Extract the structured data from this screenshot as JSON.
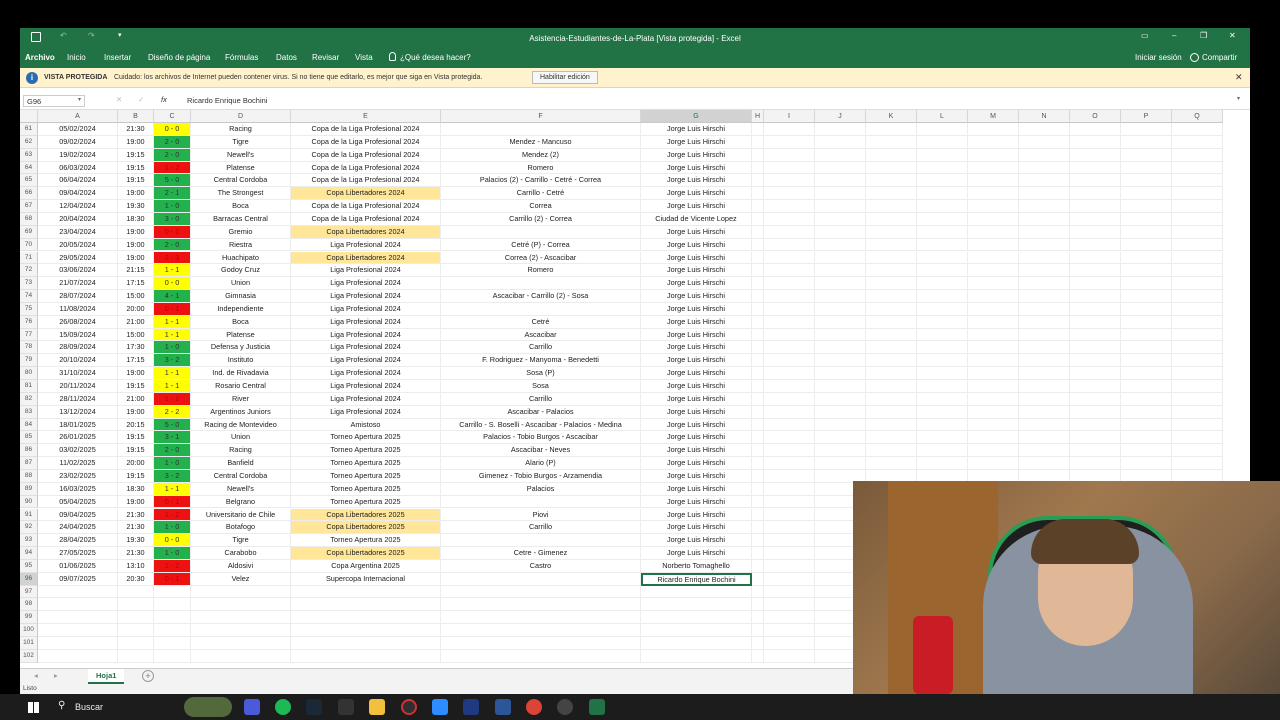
{
  "window": {
    "title": "Asistencia-Estudiantes-de-La-Plata  [Vista protegida]  -  Excel"
  },
  "ribbon": {
    "tabs": [
      "Archivo",
      "Inicio",
      "Insertar",
      "Diseño de página",
      "Fórmulas",
      "Datos",
      "Revisar",
      "Vista"
    ],
    "tell_me": "¿Qué desea hacer?",
    "signin": "Iniciar sesión",
    "share": "Compartir"
  },
  "protected": {
    "label": "VISTA PROTEGIDA",
    "message": "Cuidado: los archivos de Internet pueden contener virus. Si no tiene que editarlo, es mejor que siga en Vista protegida.",
    "enable_button": "Habilitar edición"
  },
  "formula": {
    "name_box": "G96",
    "fx": "fx",
    "value": "Ricardo Enrique Bochini"
  },
  "columns": [
    "A",
    "B",
    "C",
    "D",
    "E",
    "F",
    "G",
    "H",
    "I",
    "J",
    "K",
    "L",
    "M",
    "N",
    "O",
    "P",
    "Q"
  ],
  "colors": {
    "green": "#22b14c",
    "yellow": "#ffff00",
    "red": "#ee1111",
    "copa": "#ffe699",
    "excel": "#217346"
  },
  "rows": [
    {
      "n": "61",
      "a": "05/02/2024",
      "b": "21:30",
      "c": "0 - 0",
      "r": "D",
      "d": "Racing",
      "e": "Copa de la Liga Profesional 2024",
      "f": "",
      "g": "Jorge Luis Hirschi"
    },
    {
      "n": "62",
      "a": "09/02/2024",
      "b": "19:00",
      "c": "2 - 0",
      "r": "W",
      "d": "Tigre",
      "e": "Copa de la Liga Profesional 2024",
      "f": "Mendez - Mancuso",
      "g": "Jorge Luis Hirschi"
    },
    {
      "n": "63",
      "a": "19/02/2024",
      "b": "19:15",
      "c": "2 - 0",
      "r": "W",
      "d": "Newell's",
      "e": "Copa de la Liga Profesional 2024",
      "f": "Mendez (2)",
      "g": "Jorge Luis Hirschi"
    },
    {
      "n": "64",
      "a": "06/03/2024",
      "b": "19:15",
      "c": "1 - 2",
      "r": "L",
      "d": "Platense",
      "e": "Copa de la Liga Profesional 2024",
      "f": "Romero",
      "g": "Jorge Luis Hirschi"
    },
    {
      "n": "65",
      "a": "06/04/2024",
      "b": "19:15",
      "c": "5 - 0",
      "r": "W",
      "d": "Central Cordoba",
      "e": "Copa de la Liga Profesional 2024",
      "f": "Palacios (2) - Carrillo - Cetré - Correa",
      "g": "Jorge Luis Hirschi"
    },
    {
      "n": "66",
      "a": "09/04/2024",
      "b": "19:00",
      "c": "2 - 1",
      "r": "W",
      "d": "The Strongest",
      "e": "Copa Libertadores 2024",
      "f": "Carrillo - Cetré",
      "g": "Jorge Luis Hirschi"
    },
    {
      "n": "67",
      "a": "12/04/2024",
      "b": "19:30",
      "c": "1 - 0",
      "r": "W",
      "d": "Boca",
      "e": "Copa de la Liga Profesional 2024",
      "f": "Correa",
      "g": "Jorge Luis Hirschi"
    },
    {
      "n": "68",
      "a": "20/04/2024",
      "b": "18:30",
      "c": "3 - 0",
      "r": "W",
      "d": "Barracas Central",
      "e": "Copa de la Liga Profesional 2024",
      "f": "Carrillo (2) - Correa",
      "g": "Ciudad de Vicente Lopez"
    },
    {
      "n": "69",
      "a": "23/04/2024",
      "b": "19:00",
      "c": "0 - 1",
      "r": "L",
      "d": "Gremio",
      "e": "Copa Libertadores 2024",
      "f": "",
      "g": "Jorge Luis Hirschi"
    },
    {
      "n": "70",
      "a": "20/05/2024",
      "b": "19:00",
      "c": "2 - 0",
      "r": "W",
      "d": "Riestra",
      "e": "Liga Profesional 2024",
      "f": "Cetré (P) - Correa",
      "g": "Jorge Luis Hirschi"
    },
    {
      "n": "71",
      "a": "29/05/2024",
      "b": "19:00",
      "c": "2 - 3",
      "r": "L",
      "d": "Huachipato",
      "e": "Copa Libertadores 2024",
      "f": "Correa (2) - Ascacibar",
      "g": "Jorge Luis Hirschi"
    },
    {
      "n": "72",
      "a": "03/06/2024",
      "b": "21:15",
      "c": "1 - 1",
      "r": "D",
      "d": "Godoy Cruz",
      "e": "Liga Profesional 2024",
      "f": "Romero",
      "g": "Jorge Luis Hirschi"
    },
    {
      "n": "73",
      "a": "21/07/2024",
      "b": "17:15",
      "c": "0 - 0",
      "r": "D",
      "d": "Union",
      "e": "Liga Profesional 2024",
      "f": "",
      "g": "Jorge Luis Hirschi"
    },
    {
      "n": "74",
      "a": "28/07/2024",
      "b": "15:00",
      "c": "4 - 1",
      "r": "W",
      "d": "Gimnasia",
      "e": "Liga Profesional 2024",
      "f": "Ascacibar - Carrillo (2) - Sosa",
      "g": "Jorge Luis Hirschi"
    },
    {
      "n": "75",
      "a": "11/08/2024",
      "b": "20:00",
      "c": "0 - 1",
      "r": "L",
      "d": "Independiente",
      "e": "Liga Profesional 2024",
      "f": "",
      "g": "Jorge Luis Hirschi"
    },
    {
      "n": "76",
      "a": "26/08/2024",
      "b": "21:00",
      "c": "1 - 1",
      "r": "D",
      "d": "Boca",
      "e": "Liga Profesional 2024",
      "f": "Cetré",
      "g": "Jorge Luis Hirschi"
    },
    {
      "n": "77",
      "a": "15/09/2024",
      "b": "15:00",
      "c": "1 - 1",
      "r": "D",
      "d": "Platense",
      "e": "Liga Profesional 2024",
      "f": "Ascacibar",
      "g": "Jorge Luis Hirschi"
    },
    {
      "n": "78",
      "a": "28/09/2024",
      "b": "17:30",
      "c": "1 - 0",
      "r": "W",
      "d": "Defensa y Justicia",
      "e": "Liga Profesional 2024",
      "f": "Carrillo",
      "g": "Jorge Luis Hirschi"
    },
    {
      "n": "79",
      "a": "20/10/2024",
      "b": "17:15",
      "c": "3 - 2",
      "r": "W",
      "d": "Instituto",
      "e": "Liga Profesional 2024",
      "f": "F. Rodriguez - Manyoma - Benedetti",
      "g": "Jorge Luis Hirschi"
    },
    {
      "n": "80",
      "a": "31/10/2024",
      "b": "19:00",
      "c": "1 - 1",
      "r": "D",
      "d": "Ind. de Rivadavia",
      "e": "Liga Profesional 2024",
      "f": "Sosa (P)",
      "g": "Jorge Luis Hirschi"
    },
    {
      "n": "81",
      "a": "20/11/2024",
      "b": "19:15",
      "c": "1 - 1",
      "r": "D",
      "d": "Rosario Central",
      "e": "Liga Profesional 2024",
      "f": "Sosa",
      "g": "Jorge Luis Hirschi"
    },
    {
      "n": "82",
      "a": "28/11/2024",
      "b": "21:00",
      "c": "1 - 2",
      "r": "L",
      "d": "River",
      "e": "Liga Profesional 2024",
      "f": "Carrillo",
      "g": "Jorge Luis Hirschi"
    },
    {
      "n": "83",
      "a": "13/12/2024",
      "b": "19:00",
      "c": "2 - 2",
      "r": "D",
      "d": "Argentinos Juniors",
      "e": "Liga Profesional 2024",
      "f": "Ascacibar - Palacios",
      "g": "Jorge Luis Hirschi"
    },
    {
      "n": "84",
      "a": "18/01/2025",
      "b": "20:15",
      "c": "5 - 0",
      "r": "W",
      "d": "Racing de Montevideo",
      "e": "Amistoso",
      "f": "Carrillo - S. Boselli - Ascacibar - Palacios - Medina",
      "g": "Jorge Luis Hirschi"
    },
    {
      "n": "85",
      "a": "26/01/2025",
      "b": "19:15",
      "c": "3 - 1",
      "r": "W",
      "d": "Union",
      "e": "Torneo Apertura 2025",
      "f": "Palacios - Tobio Burgos - Ascacibar",
      "g": "Jorge Luis Hirschi"
    },
    {
      "n": "86",
      "a": "03/02/2025",
      "b": "19:15",
      "c": "2 - 0",
      "r": "W",
      "d": "Racing",
      "e": "Torneo Apertura 2025",
      "f": "Ascacibar - Neves",
      "g": "Jorge Luis Hirschi"
    },
    {
      "n": "87",
      "a": "11/02/2025",
      "b": "20:00",
      "c": "1 - 0",
      "r": "W",
      "d": "Banfield",
      "e": "Torneo Apertura 2025",
      "f": "Alario (P)",
      "g": "Jorge Luis Hirschi"
    },
    {
      "n": "88",
      "a": "23/02/2025",
      "b": "19:15",
      "c": "3 - 2",
      "r": "W",
      "d": "Central Cordoba",
      "e": "Torneo Apertura 2025",
      "f": "Gimenez - Tobio Burgos - Arzamendia",
      "g": "Jorge Luis Hirschi"
    },
    {
      "n": "89",
      "a": "16/03/2025",
      "b": "18:30",
      "c": "1 - 1",
      "r": "D",
      "d": "Newell's",
      "e": "Torneo Apertura 2025",
      "f": "Palacios",
      "g": "Jorge Luis Hirschi"
    },
    {
      "n": "90",
      "a": "05/04/2025",
      "b": "19:00",
      "c": "0 - 1",
      "r": "L",
      "d": "Belgrano",
      "e": "Torneo Apertura 2025",
      "f": "",
      "g": "Jorge Luis Hirschi"
    },
    {
      "n": "91",
      "a": "09/04/2025",
      "b": "21:30",
      "c": "1 - 2",
      "r": "L",
      "d": "Universitario de Chile",
      "e": "Copa Libertadores 2025",
      "f": "Piovi",
      "g": "Jorge Luis Hirschi"
    },
    {
      "n": "92",
      "a": "24/04/2025",
      "b": "21:30",
      "c": "1 - 0",
      "r": "W",
      "d": "Botafogo",
      "e": "Copa Libertadores 2025",
      "f": "Carrillo",
      "g": "Jorge Luis Hirschi"
    },
    {
      "n": "93",
      "a": "28/04/2025",
      "b": "19:30",
      "c": "0 - 0",
      "r": "D",
      "d": "Tigre",
      "e": "Torneo Apertura 2025",
      "f": "",
      "g": "Jorge Luis Hirschi"
    },
    {
      "n": "94",
      "a": "27/05/2025",
      "b": "21:30",
      "c": "1 - 0",
      "r": "W",
      "d": "Carabobo",
      "e": "Copa Libertadores 2025",
      "f": "Cetre - Gimenez",
      "g": "Jorge Luis Hirschi"
    },
    {
      "n": "95",
      "a": "01/06/2025",
      "b": "13:10",
      "c": "1 - 2",
      "r": "L",
      "d": "Aldosivi",
      "e": "Copa Argentina 2025",
      "f": "Castro",
      "g": "Norberto Tomaghello"
    },
    {
      "n": "96",
      "a": "09/07/2025",
      "b": "20:30",
      "c": "0 - 1",
      "r": "L",
      "d": "Velez",
      "e": "Supercopa Internacional",
      "f": "",
      "g": "Ricardo Enrique Bochini"
    },
    {
      "n": "97"
    },
    {
      "n": "98"
    },
    {
      "n": "99"
    },
    {
      "n": "100"
    },
    {
      "n": "101"
    },
    {
      "n": "102"
    }
  ],
  "sheet_tab": "Hoja1",
  "status": "Listo",
  "taskbar": {
    "search": "Buscar"
  }
}
